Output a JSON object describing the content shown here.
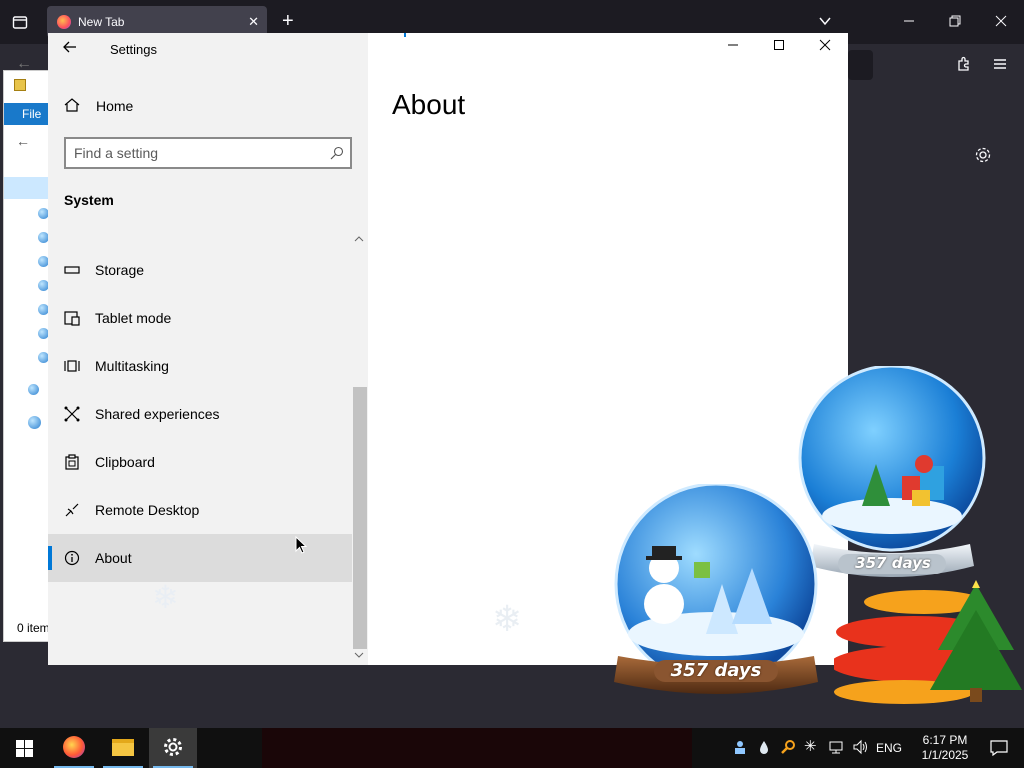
{
  "firefox": {
    "tab_title": "New Tab",
    "tab_close": "✕",
    "new_tab": "+"
  },
  "explorer": {
    "menu_file": "File",
    "status_items": "0 item"
  },
  "settings": {
    "window_title": "Settings",
    "home_label": "Home",
    "search_placeholder": "Find a setting",
    "section_title": "System",
    "nav_items": [
      {
        "label": "Storage",
        "icon": "storage-icon"
      },
      {
        "label": "Tablet mode",
        "icon": "tablet-mode-icon"
      },
      {
        "label": "Multitasking",
        "icon": "multitasking-icon"
      },
      {
        "label": "Shared experiences",
        "icon": "shared-experiences-icon"
      },
      {
        "label": "Clipboard",
        "icon": "clipboard-icon"
      },
      {
        "label": "Remote Desktop",
        "icon": "remote-desktop-icon"
      },
      {
        "label": "About",
        "icon": "info-icon",
        "active": true
      }
    ],
    "page_heading": "About",
    "accent_color": "#0078d7"
  },
  "decorations": {
    "globe_counter_1": "357 days",
    "globe_counter_2": "357 days"
  },
  "taskbar": {
    "apps": [
      "firefox-icon",
      "file-explorer-icon",
      "settings-gear-icon"
    ],
    "active_app": "settings-gear-icon",
    "language": "ENG",
    "time": "6:17 PM",
    "date": "1/1/2025"
  }
}
